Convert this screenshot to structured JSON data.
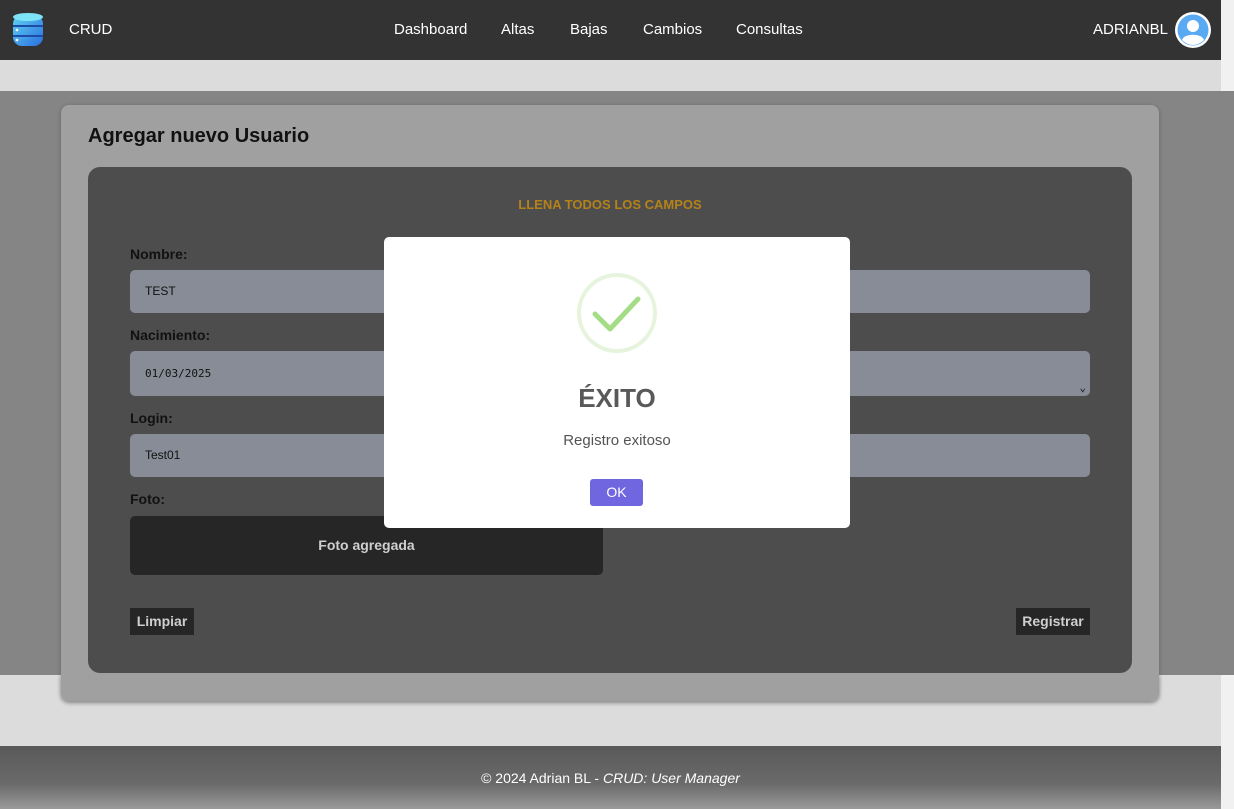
{
  "navbar": {
    "brand": "CRUD",
    "links": [
      "Dashboard",
      "Altas",
      "Bajas",
      "Cambios",
      "Consultas"
    ],
    "user": "ADRIANBL"
  },
  "card": {
    "title": "Agregar nuevo Usuario",
    "notice": "LLENA TODOS LOS CAMPOS"
  },
  "form": {
    "nombre_label": "Nombre:",
    "nombre_value": "TEST",
    "nacimiento_label": "Nacimiento:",
    "nacimiento_value": "01/03/2025",
    "login_label": "Login:",
    "login_value": "Test01",
    "foto_label": "Foto:",
    "foto_status": "Foto agregada",
    "clear_button": "Limpiar",
    "submit_button": "Registrar"
  },
  "footer": {
    "text": "© 2024 Adrian BL - ",
    "italic": "CRUD: User Manager"
  },
  "modal": {
    "title": "ÉXITO",
    "message": "Registro exitoso",
    "ok": "OK"
  },
  "colors": {
    "navbar": "#333333",
    "notice": "#b5821a",
    "ok_button": "#7066e0",
    "success_check": "#a5dc86"
  },
  "icons": {
    "logo": "database-icon",
    "avatar": "user-avatar-icon",
    "success": "checkmark-circle-icon",
    "select": "chevron-down-icon"
  }
}
